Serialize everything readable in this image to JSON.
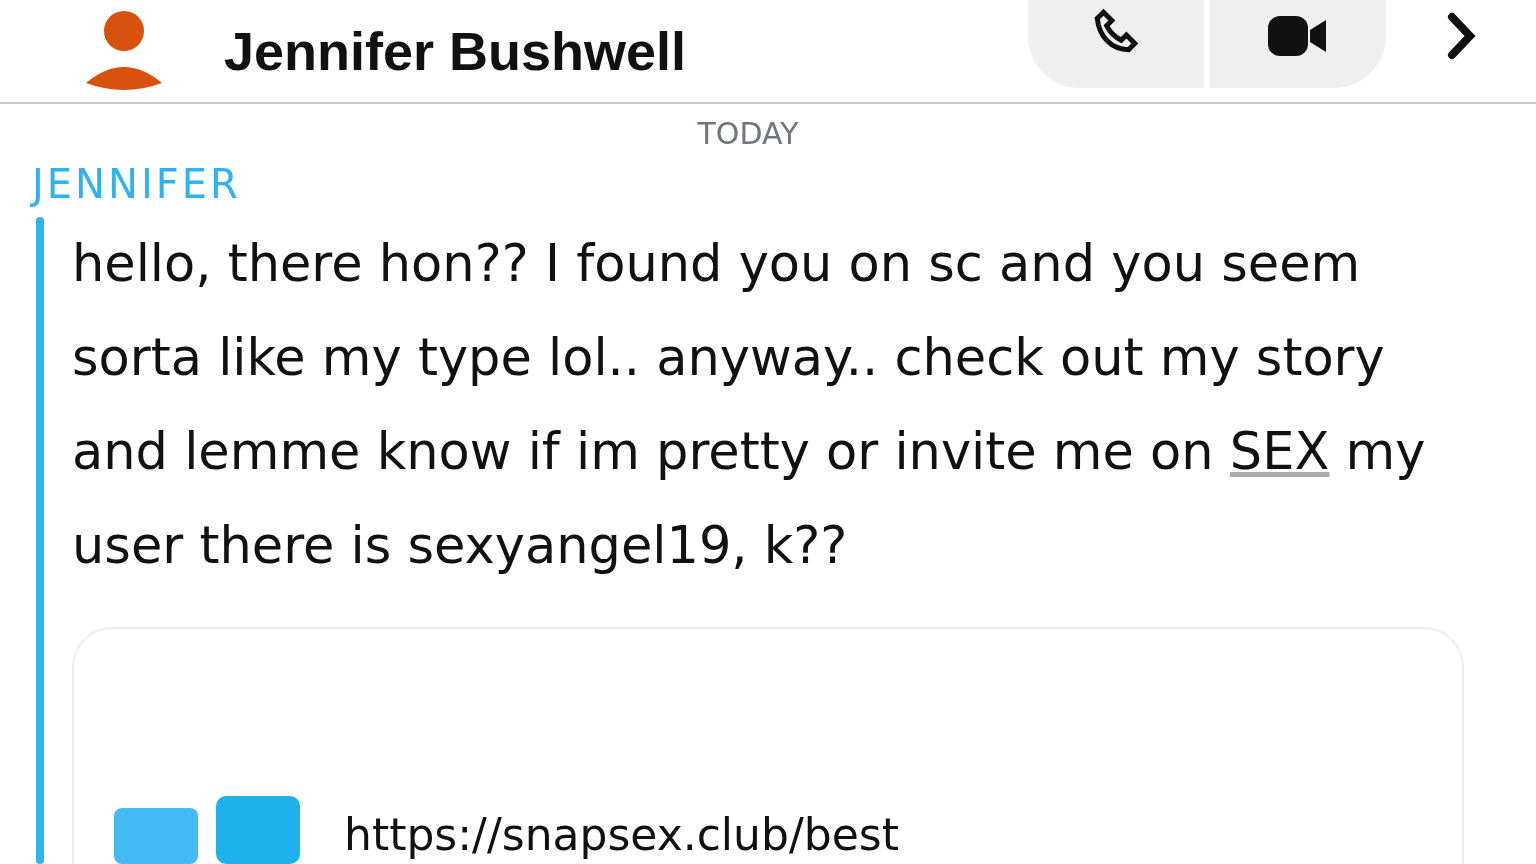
{
  "header": {
    "name": "Jennifer Bushwell"
  },
  "date_label": "TODAY",
  "sender": "JENNIFER",
  "message": {
    "parts": [
      {
        "kind": "text",
        "text": "hello, there hon?? I found you on sc and you seem sorta like my type lol.. anyway.. check out my story and lemme know if im pretty or invite me on "
      },
      {
        "kind": "link",
        "text": "SEX"
      },
      {
        "kind": "text",
        "text": " my user there is sexyangel19, k??"
      }
    ]
  },
  "link_card": {
    "url": "https://snapsex.club/best"
  }
}
